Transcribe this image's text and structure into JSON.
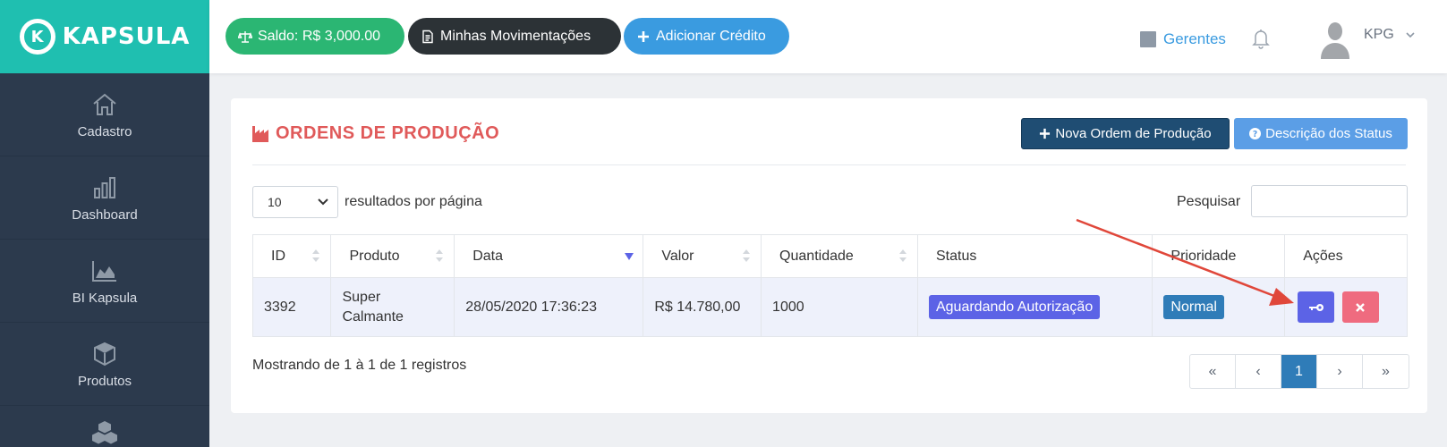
{
  "brand": {
    "name": "KAPSULA",
    "mark": "K"
  },
  "sidebar": {
    "items": [
      {
        "label": "Cadastro",
        "icon": "home-icon"
      },
      {
        "label": "Dashboard",
        "icon": "bars-icon"
      },
      {
        "label": "BI Kapsula",
        "icon": "area-chart-icon"
      },
      {
        "label": "Produtos",
        "icon": "box-icon"
      },
      {
        "label": "",
        "icon": "cubes-icon"
      }
    ]
  },
  "topbar": {
    "saldo": "Saldo: R$ 3,000.00",
    "movimentacoes": "Minhas Movimentações",
    "adicionar": "Adicionar Crédito",
    "gerentes": "Gerentes",
    "user": "KPG"
  },
  "page": {
    "title": "ORDENS DE PRODUÇÃO",
    "nova_ordem": "Nova Ordem de Produção",
    "descricao_status": "Descrição dos Status",
    "per_page_value": "10",
    "per_page_label": "resultados por página",
    "search_label": "Pesquisar",
    "search_value": ""
  },
  "table": {
    "headers": [
      "ID",
      "Produto",
      "Data",
      "Valor",
      "Quantidade",
      "Status",
      "Prioridade",
      "Ações"
    ],
    "rows": [
      {
        "id": "3392",
        "produto": "Super Calmante",
        "data": "28/05/2020 17:36:23",
        "valor": "R$ 14.780,00",
        "quantidade": "1000",
        "status": "Aguardando Autorização",
        "prioridade": "Normal"
      }
    ]
  },
  "footer": {
    "showing": "Mostrando de 1 à 1 de 1 registros",
    "pager": [
      "«",
      "‹",
      "1",
      "›",
      "»"
    ]
  },
  "colors": {
    "sidebar": "#2c3a4d",
    "logo_bg": "#1fbfb0",
    "title_red": "#e05a5a",
    "badge_purple": "#5c63e6",
    "badge_blue": "#2f7cb8",
    "arrow": "#e0473a"
  }
}
